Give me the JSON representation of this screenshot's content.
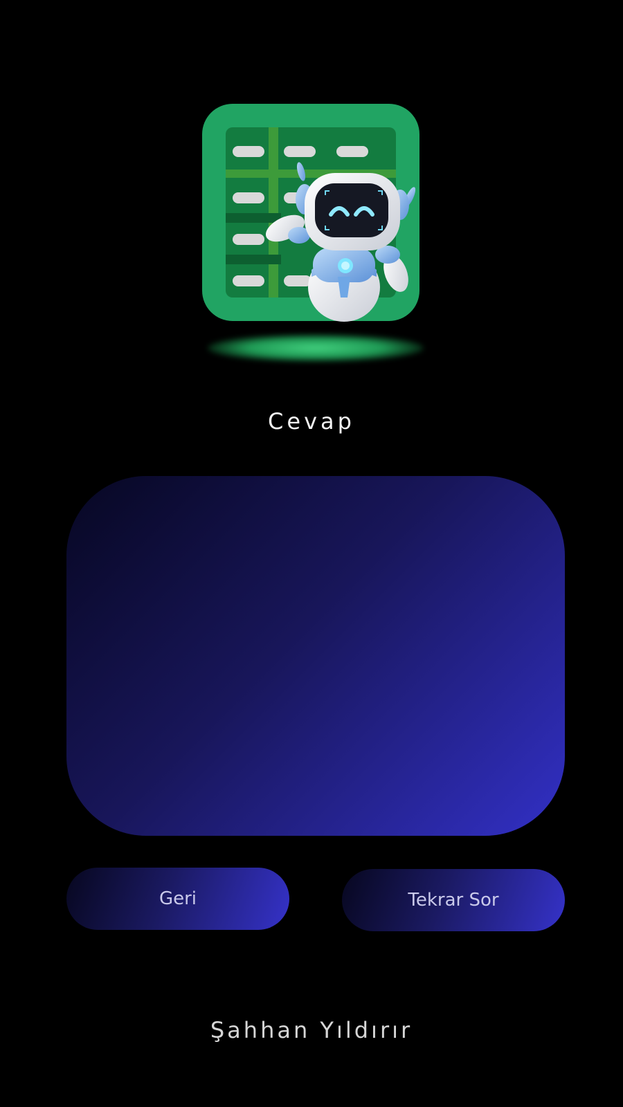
{
  "header": {
    "logo_icon": "spreadsheet-robot-icon",
    "title": "Cevap"
  },
  "answer": {
    "text": ""
  },
  "actions": {
    "back_label": "Geri",
    "retry_label": "Tekrar Sor"
  },
  "footer": {
    "author": "Şahhan Yıldırır"
  },
  "colors": {
    "background": "#000000",
    "logo_green": "#21a463",
    "gradient_dark": "#07071f",
    "gradient_light": "#3532c9"
  }
}
